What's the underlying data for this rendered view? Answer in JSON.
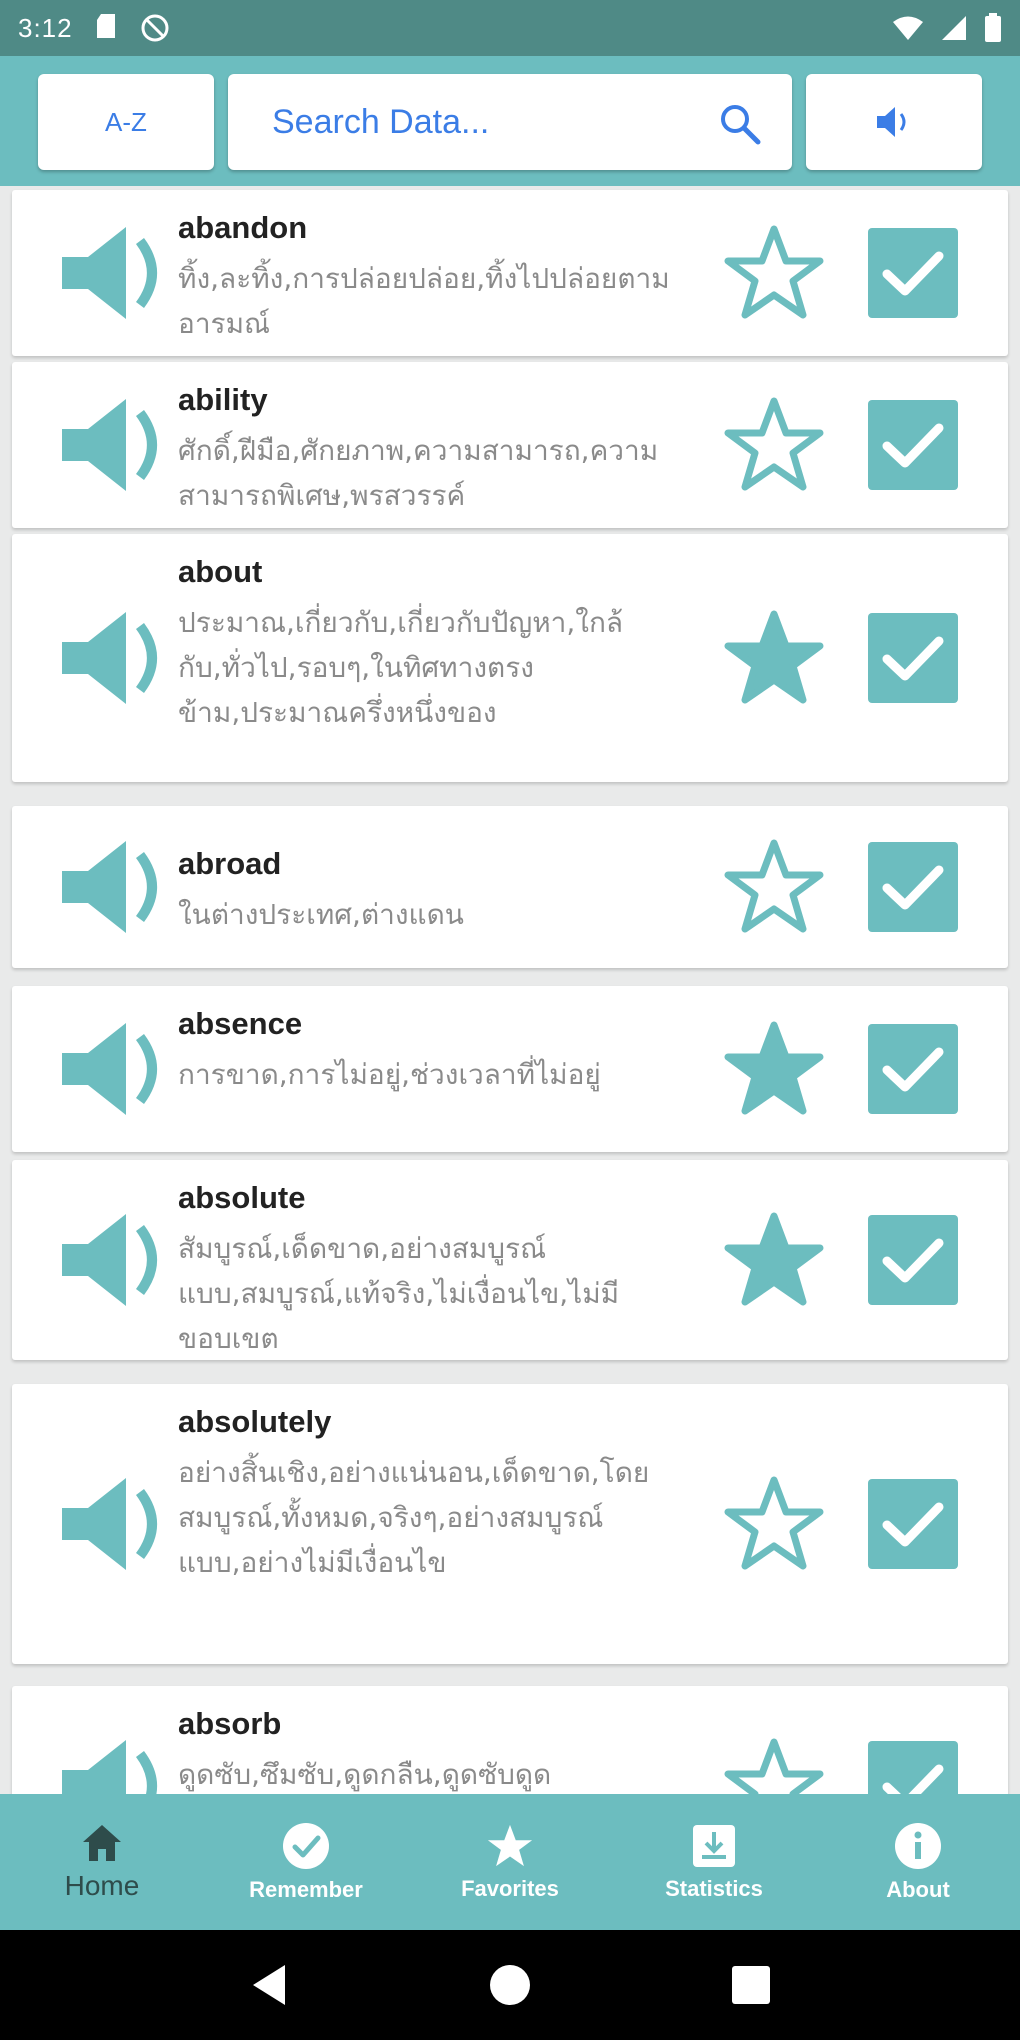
{
  "status_bar": {
    "time": "3:12"
  },
  "toolbar": {
    "sort_label": "A-Z",
    "search_placeholder": "Search Data..."
  },
  "colors": {
    "accent": "#6cbdbf",
    "header": "#4f8a86",
    "link": "#3b7de6"
  },
  "words": [
    {
      "word": "abandon",
      "meaning": "ทิ้ง,ละทิ้ง,การปล่อยปล่อย,ทิ้งไปปล่อยตามอารมณ์",
      "favorite": false,
      "remembered": true
    },
    {
      "word": "ability",
      "meaning": "ศักดิ์,ฝีมือ,ศักยภาพ,ความสามารถ,ความสามารถพิเศษ,พรสวรรค์",
      "favorite": false,
      "remembered": true
    },
    {
      "word": "about",
      "meaning": "ประมาณ,เกี่ยวกับ,เกี่ยวกับปัญหา,ใกล้กับ,ทั่วไป,รอบๆ,ในทิศทางตรงข้าม,ประมาณครึ่งหนึ่งของ",
      "favorite": true,
      "remembered": true
    },
    {
      "word": "abroad",
      "meaning": "ในต่างประเทศ,ต่างแดน",
      "favorite": false,
      "remembered": true
    },
    {
      "word": "absence",
      "meaning": "การขาด,การไม่อยู่,ช่วงเวลาที่ไม่อยู่",
      "favorite": true,
      "remembered": true
    },
    {
      "word": "absolute",
      "meaning": "สัมบูรณ์,เด็ดขาด,อย่างสมบูรณ์แบบ,สมบูรณ์,แท้จริง,ไม่เงื่อนไข,ไม่มีขอบเขต",
      "favorite": true,
      "remembered": true
    },
    {
      "word": "absolutely",
      "meaning": "อย่างสิ้นเชิง,อย่างแน่นอน,เด็ดขาด,โดยสมบูรณ์,ทั้งหมด,จริงๆ,อย่างสมบูรณ์แบบ,อย่างไม่มีเงื่อนไข",
      "favorite": false,
      "remembered": true
    },
    {
      "word": "absorb",
      "meaning": "ดูดซับ,ซึมซับ,ดูดกลืน,ดูดซับดูด",
      "favorite": false,
      "remembered": true
    }
  ],
  "bottom_nav": [
    {
      "label": "Home",
      "icon": "home-icon"
    },
    {
      "label": "Remember",
      "icon": "check-circle-icon"
    },
    {
      "label": "Favorites",
      "icon": "star-icon"
    },
    {
      "label": "Statistics",
      "icon": "download-box-icon"
    },
    {
      "label": "About",
      "icon": "info-icon"
    }
  ]
}
